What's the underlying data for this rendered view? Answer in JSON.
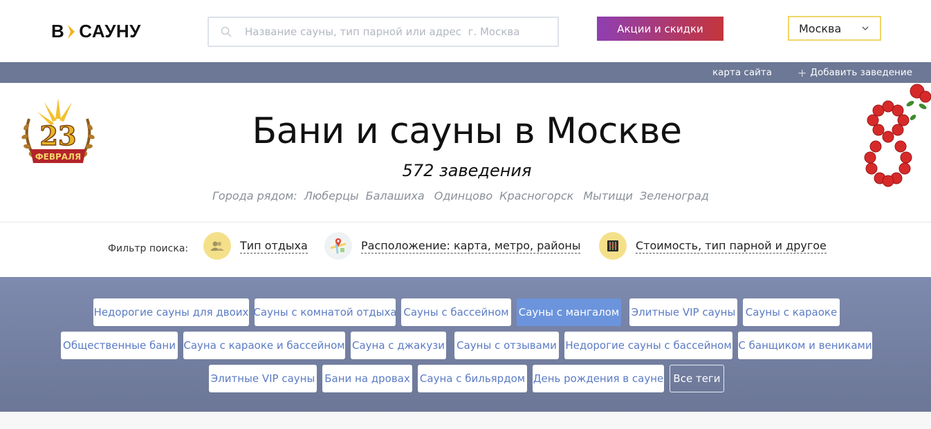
{
  "header": {
    "logo_left": "В",
    "logo_right": "САУНУ",
    "search_placeholder": "Название сауны, тип парной или адрес  г. Москва",
    "promo_label": "Акции и скидки",
    "city_label": "Москва"
  },
  "topbar": {
    "sitemap_label": "карта сайта",
    "add_label": "Добавить заведение"
  },
  "hero": {
    "title": "Бани и сауны в Москве",
    "count": "572 заведения",
    "nearby_label": "Города рядом:",
    "nearby_cities": [
      "Люберцы",
      "Балашиха",
      "Одинцово",
      "Красногорск",
      "Мытищи",
      "Зеленоград"
    ],
    "badge_number": "23",
    "badge_text": "ФЕВРАЛЯ"
  },
  "filters": {
    "label": "Фильтр поиска:",
    "items": [
      {
        "label": "Тип отдыха",
        "icon": "people-icon"
      },
      {
        "label": "Расположение: карта, метро, районы",
        "icon": "map-pin-icon"
      },
      {
        "label": "Стоимость, тип парной и другое",
        "icon": "sliders-icon"
      }
    ]
  },
  "tags": {
    "row1": [
      "Недорогие сауны для двоих",
      "Сауны с комнатой отдыха",
      "Сауны с бассейном",
      "Сауны с мангалом",
      "Элитные VIP сауны",
      "Сауны с караоке"
    ],
    "row2": [
      "Общественные бани",
      "Сауна с караоке и бассейном",
      "Сауна с джакузи",
      "Сауны с отзывами",
      "Недорогие сауны с бассейном",
      "С банщиком и вениками"
    ],
    "row3": [
      "Элитные VIP сауны",
      "Бани на дровах",
      "Сауна с бильярдом",
      "День рождения в сауне"
    ],
    "all_label": "Все теги",
    "active": "Сауны с мангалом"
  },
  "colors": {
    "topbar": "#6c7895",
    "tags_bg": "#7e8aae",
    "tag_text": "#5b7bc4",
    "tag_active": "#6b94dd",
    "city_border": "#f1d568",
    "filter_circle": "#f5e08a",
    "promo_from": "#8e3fb2",
    "promo_to": "#c4353c"
  }
}
